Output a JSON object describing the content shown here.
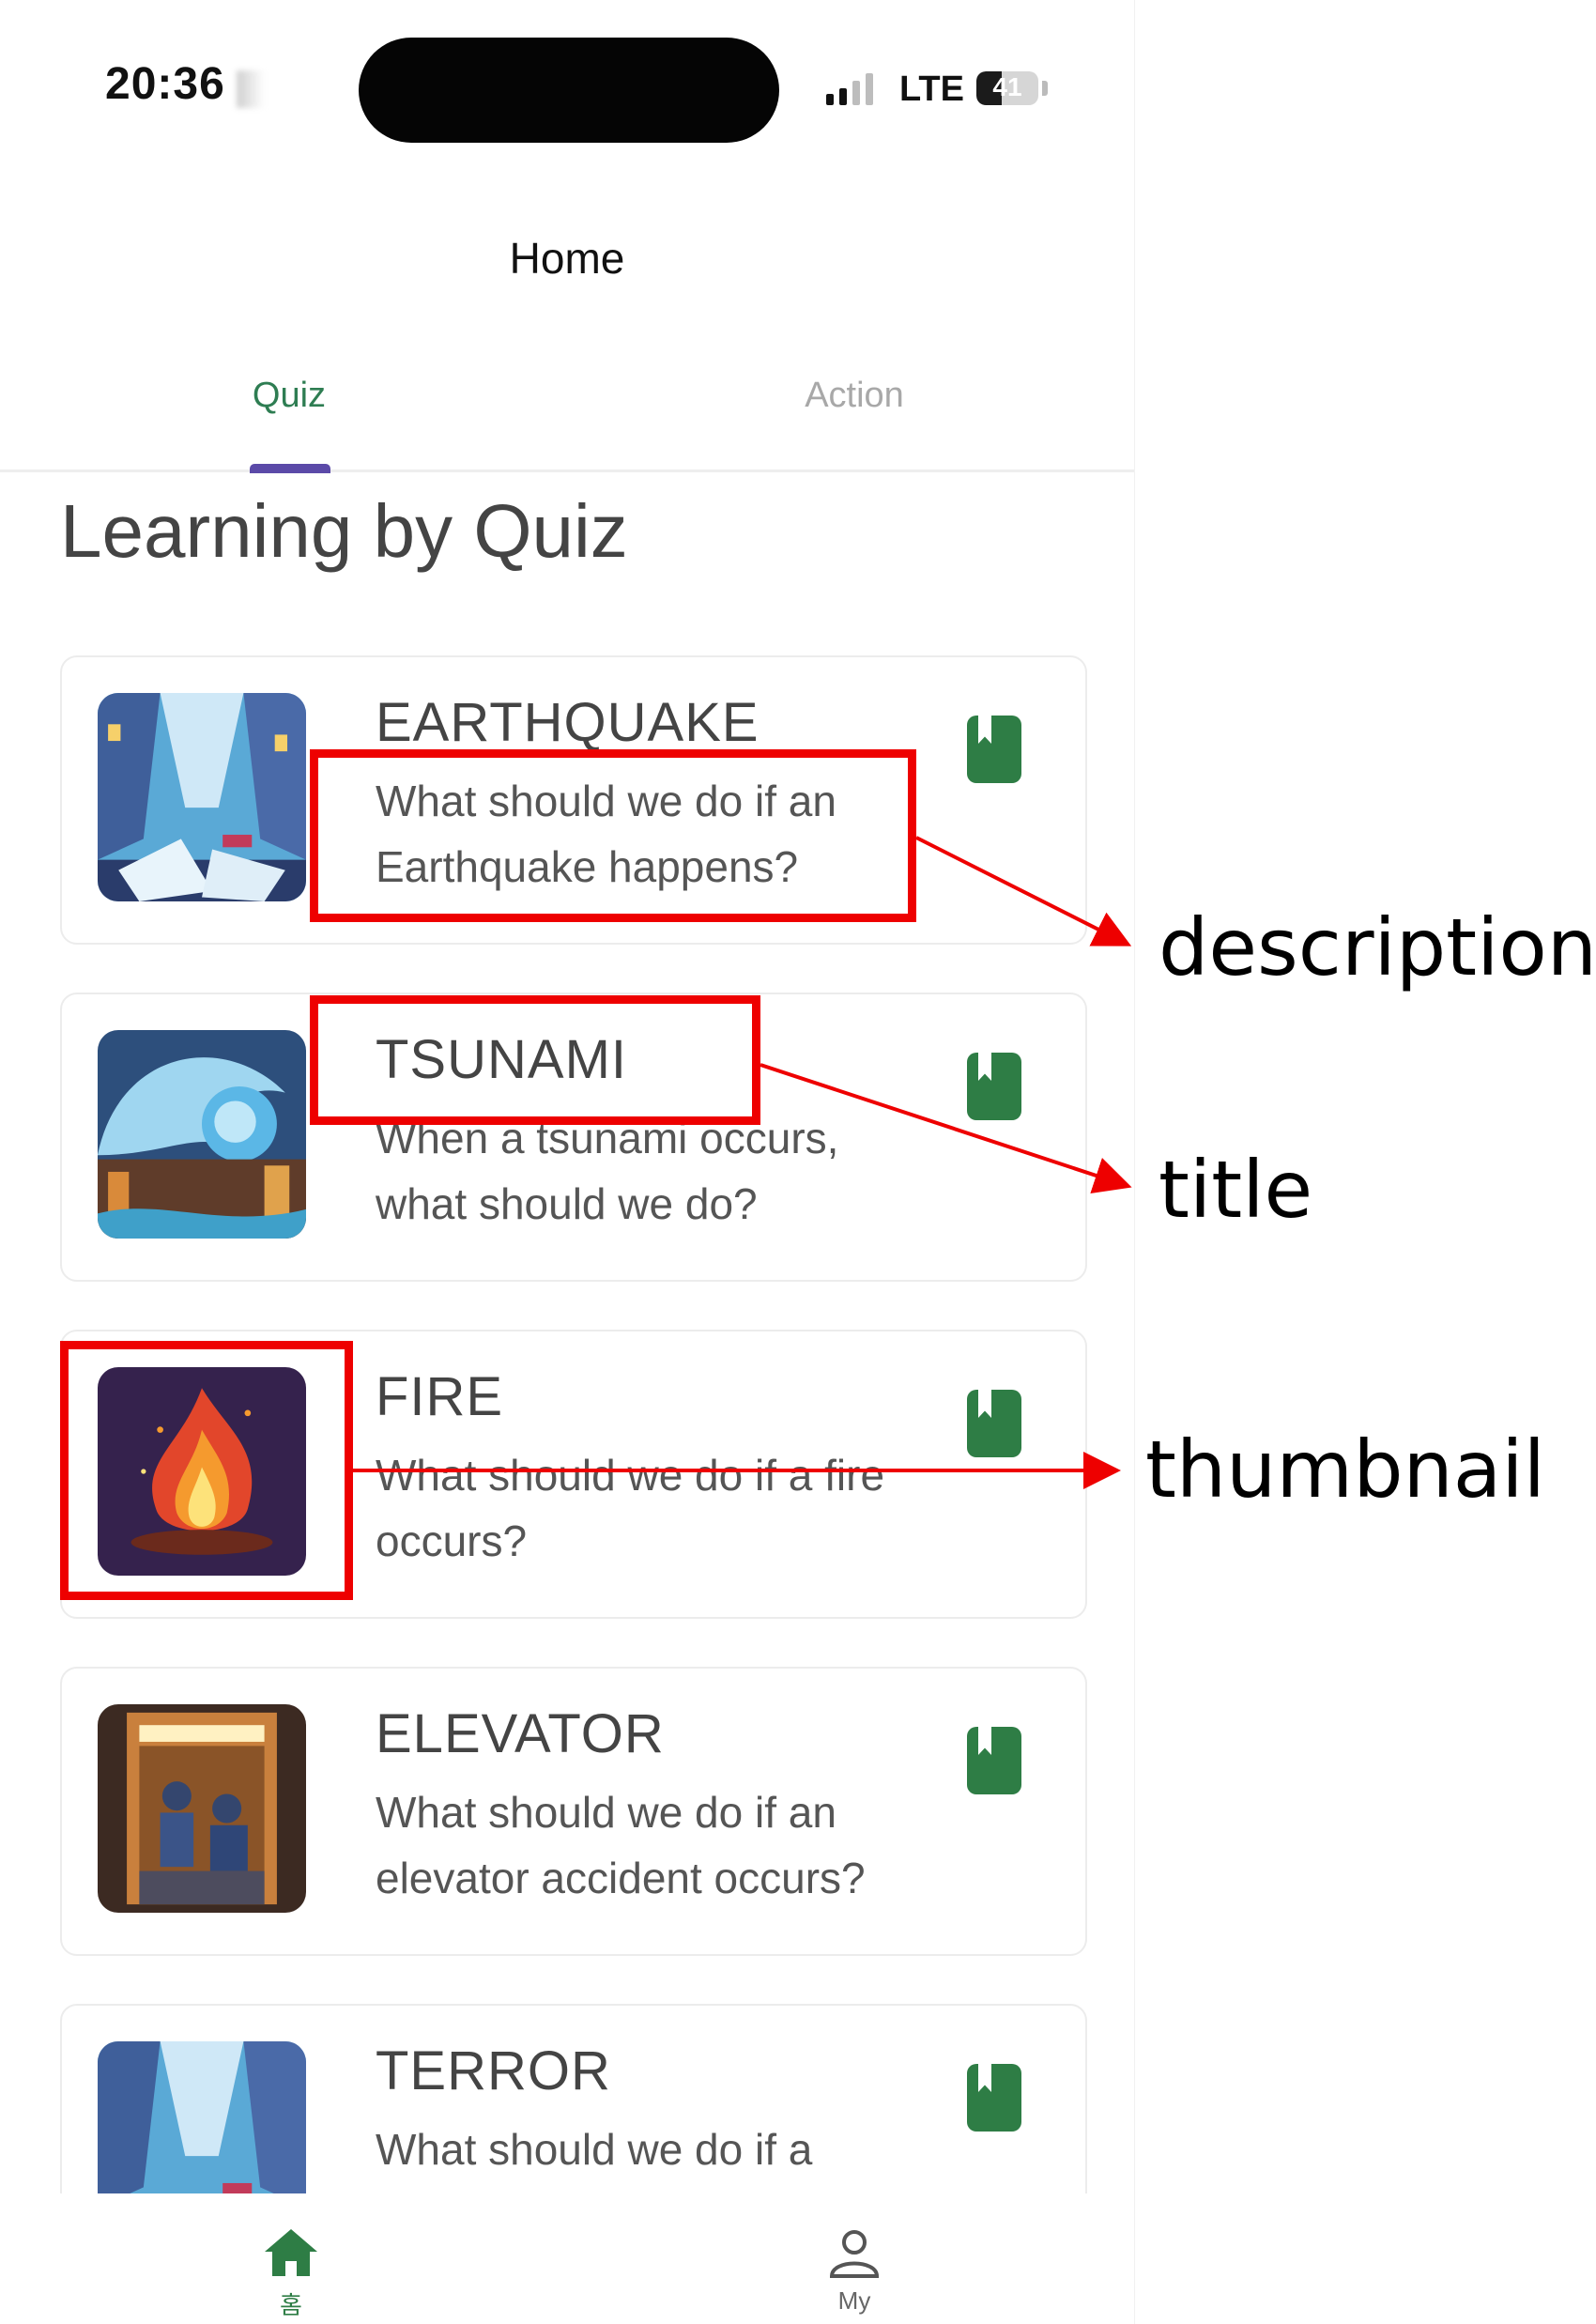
{
  "status_bar": {
    "time": "20:36",
    "network": "LTE",
    "battery": "41"
  },
  "header": {
    "title": "Home"
  },
  "tabs": [
    {
      "label": "Quiz",
      "active": true
    },
    {
      "label": "Action",
      "active": false
    }
  ],
  "section_title": "Learning by Quiz",
  "quizzes": [
    {
      "title": "EARTHQUAKE",
      "description": "What should we do if an Earthquake happens?"
    },
    {
      "title": "TSUNAMI",
      "description": "When a tsunami occurs, what should we do?"
    },
    {
      "title": "FIRE",
      "description": "What should we do if a fire occurs?"
    },
    {
      "title": "ELEVATOR",
      "description": "What should we do if an elevator accident occurs?"
    },
    {
      "title": "TERROR",
      "description": "What should we do if a"
    }
  ],
  "bottom_nav": [
    {
      "label": "홈",
      "icon": "home-icon",
      "active": true
    },
    {
      "label": "My",
      "icon": "person-icon",
      "active": false
    }
  ],
  "annotations": {
    "description": "description",
    "title": "title",
    "thumbnail": "thumbnail"
  },
  "colors": {
    "accent_green": "#2e7d45",
    "tab_indicator": "#5b4aa8",
    "annotation_red": "#ee0000"
  }
}
